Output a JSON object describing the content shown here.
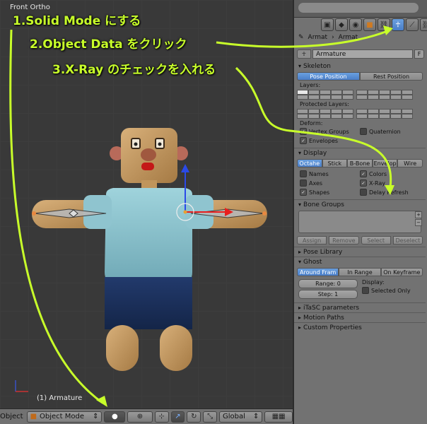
{
  "viewport": {
    "title": "Front Ortho",
    "status": "(1) Armature"
  },
  "annotations": {
    "step1": "1.Solid Mode にする",
    "step2": "2.Object Data をクリック",
    "step3": "3.X-Ray のチェックを入れる",
    "color": "#c8ff2a"
  },
  "header": {
    "object_label": "Object",
    "mode": "Object Mode",
    "transform_orientation": "Global"
  },
  "properties": {
    "breadcrumb": [
      "Armat",
      "Armat"
    ],
    "name_field": "Armature",
    "name_flag": "F",
    "skeleton": {
      "title": "Skeleton",
      "pose_position": "Pose Position",
      "rest_position": "Rest Position",
      "layers_label": "Layers:",
      "protected_layers_label": "Protected Layers:",
      "deform_label": "Deform:",
      "vertex_groups": "Vertex Groups",
      "envelopes": "Envelopes",
      "quaternion": "Quaternion"
    },
    "display": {
      "title": "Display",
      "modes": [
        "Octahe",
        "Stick",
        "B-Bone",
        "Envelop",
        "Wire"
      ],
      "names": "Names",
      "axes": "Axes",
      "shapes": "Shapes",
      "colors": "Colors",
      "xray": "X-Ray",
      "delay_refresh": "Delay Refresh"
    },
    "bone_groups": {
      "title": "Bone Groups",
      "assign": "Assign",
      "remove": "Remove",
      "select": "Select",
      "deselect": "Deselect"
    },
    "pose_library": "Pose Library",
    "ghost": {
      "title": "Ghost",
      "modes": [
        "Around Fram",
        "In Range",
        "On Keyframe"
      ],
      "range": "Range: 0",
      "step": "Step: 1",
      "display_label": "Display:",
      "selected_only": "Selected Only"
    },
    "itasc": "iTaSC parameters",
    "motion_paths": "Motion Paths",
    "custom_properties": "Custom Properties"
  }
}
